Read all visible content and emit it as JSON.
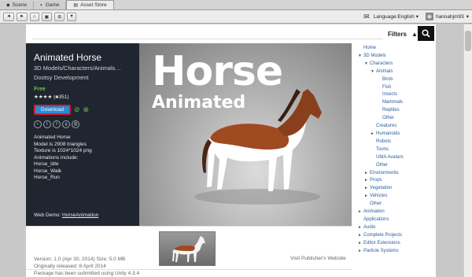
{
  "tabs": [
    {
      "label": "Scene",
      "icon": "scene-icon"
    },
    {
      "label": "Game",
      "icon": "game-icon"
    },
    {
      "label": "Asset Store",
      "icon": "store-icon"
    }
  ],
  "toolbar": {
    "back": "◄",
    "forward": "►",
    "home": "⌂",
    "download_mgr": "▣",
    "cart": "🛒",
    "favorite": "♥",
    "language": "Language:English",
    "user": "hannahjm93"
  },
  "search": {
    "placeholder": "",
    "filters_label": "Filters",
    "filters_arrow": "▲",
    "search_icon": "🔍"
  },
  "product": {
    "title": "Animated Horse",
    "category": "3D Models/Characters/Animals…",
    "publisher": "Dootsy Development",
    "price": "Free",
    "rating": "★★★★ (♣351)",
    "download_label": "Download",
    "description": [
      "Animated Horse",
      "Model is 2908 triangles",
      "Texture is 1024*1024 png",
      "Animations include:",
      "Horse_Idle",
      "Horse_Walk",
      "Horse_Run"
    ],
    "web_demo_label": "Web Demo:",
    "web_demo_link": "HorseAnimation"
  },
  "hero": {
    "line1": "Horse",
    "line2": "Animated"
  },
  "meta": {
    "version": "Version: 1.0 (Apr 30, 2014)    Size: 5.0 MB",
    "released": "Originally released: 8 April 2014",
    "submitted": "Package has been submitted using Unity 4.3.4",
    "publisher_site": "Visit Publisher's Website"
  },
  "tree": [
    {
      "label": "Home",
      "indent": 0,
      "arrow": "",
      "type": "link"
    },
    {
      "label": "3D Models",
      "indent": 0,
      "arrow": "▼",
      "type": "link"
    },
    {
      "label": "Characters",
      "indent": 1,
      "arrow": "▼",
      "type": "link"
    },
    {
      "label": "Animals",
      "indent": 2,
      "arrow": "▼",
      "type": "link"
    },
    {
      "label": "Birds",
      "indent": 3,
      "arrow": "",
      "type": "link"
    },
    {
      "label": "Fish",
      "indent": 3,
      "arrow": "",
      "type": "link"
    },
    {
      "label": "Insects",
      "indent": 3,
      "arrow": "",
      "type": "link"
    },
    {
      "label": "Mammals",
      "indent": 3,
      "arrow": "",
      "type": "link"
    },
    {
      "label": "Reptiles",
      "indent": 3,
      "arrow": "",
      "type": "link"
    },
    {
      "label": "Other",
      "indent": 3,
      "arrow": "",
      "type": "link"
    },
    {
      "label": "Creatures",
      "indent": 2,
      "arrow": "",
      "type": "link"
    },
    {
      "label": "Humanoids",
      "indent": 2,
      "arrow": "►",
      "type": "link"
    },
    {
      "label": "Robots",
      "indent": 2,
      "arrow": "",
      "type": "link"
    },
    {
      "label": "Toons",
      "indent": 2,
      "arrow": "",
      "type": "link"
    },
    {
      "label": "UMA Avatars",
      "indent": 2,
      "arrow": "",
      "type": "link"
    },
    {
      "label": "Other",
      "indent": 2,
      "arrow": "",
      "type": "link"
    },
    {
      "label": "Environments",
      "indent": 1,
      "arrow": "►",
      "type": "link"
    },
    {
      "label": "Props",
      "indent": 1,
      "arrow": "►",
      "type": "link"
    },
    {
      "label": "Vegetation",
      "indent": 1,
      "arrow": "►",
      "type": "link"
    },
    {
      "label": "Vehicles",
      "indent": 1,
      "arrow": "►",
      "type": "link"
    },
    {
      "label": "Other",
      "indent": 1,
      "arrow": "",
      "type": "link"
    },
    {
      "label": "Animation",
      "indent": 0,
      "arrow": "►",
      "type": "link"
    },
    {
      "label": "Applications",
      "indent": 0,
      "arrow": "",
      "type": "link"
    },
    {
      "label": "Audio",
      "indent": 0,
      "arrow": "►",
      "type": "link"
    },
    {
      "label": "Complete Projects",
      "indent": 0,
      "arrow": "►",
      "type": "link"
    },
    {
      "label": "Editor Extensions",
      "indent": 0,
      "arrow": "►",
      "type": "link"
    },
    {
      "label": "Particle Systems",
      "indent": 0,
      "arrow": "►",
      "type": "link"
    }
  ],
  "colors": {
    "panel_bg": "#1f2630",
    "download_btn": "#2b8bd8",
    "download_outline": "#d61f2c",
    "free_green": "#6bc04b",
    "link_blue": "#2a5e9e"
  }
}
